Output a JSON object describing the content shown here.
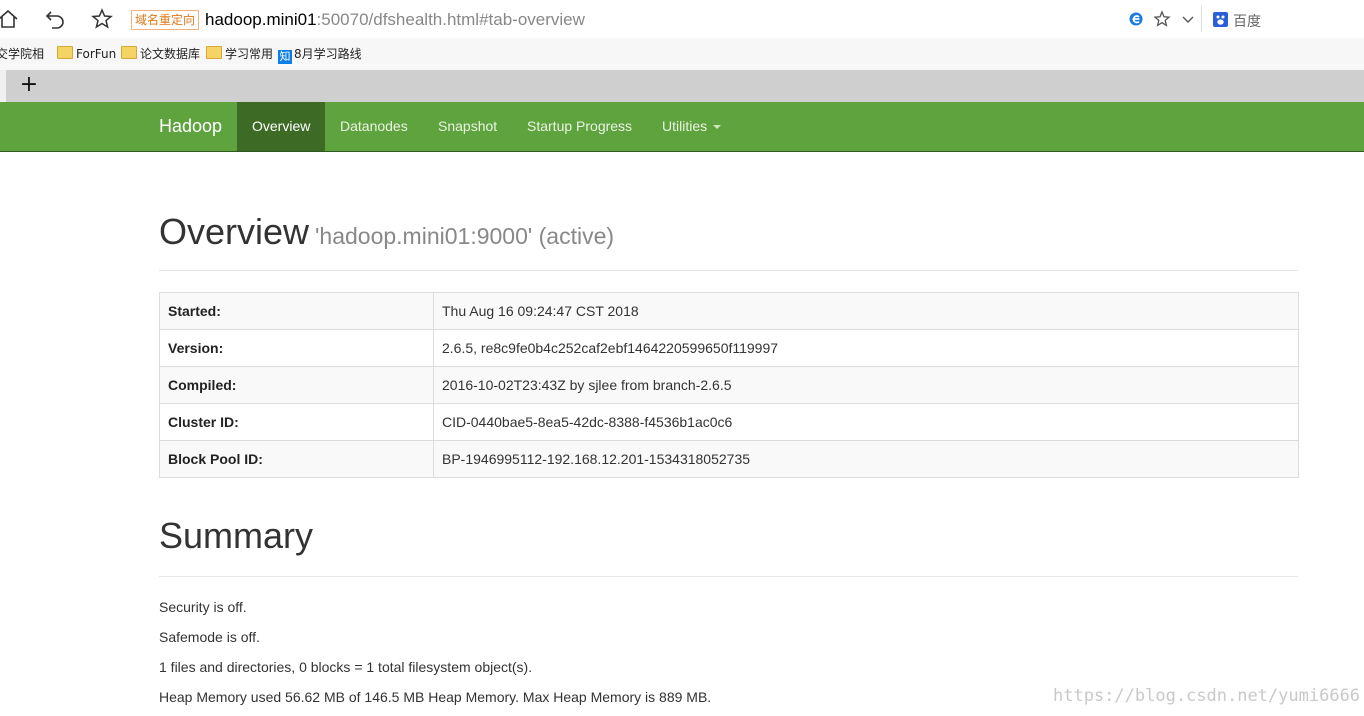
{
  "browser": {
    "redirect_badge": "域名重定向",
    "url_host": "hadoop.mini01",
    "url_rest": ":50070/dfshealth.html#tab-overview",
    "search_engine_label": "百度",
    "icons": [
      "home-icon",
      "undo-icon",
      "favorite-star-icon",
      "ie-compat-icon",
      "star-outline-icon",
      "chevron-down-icon",
      "baidu-icon"
    ]
  },
  "bookmarks": [
    {
      "label": "交学院相",
      "icon": "none"
    },
    {
      "label": "ForFun",
      "icon": "folder-icon"
    },
    {
      "label": "论文数据库",
      "icon": "folder-icon"
    },
    {
      "label": "学习常用",
      "icon": "folder-icon"
    },
    {
      "label": "8月学习路线",
      "icon": "zhihu-icon",
      "icon_text": "知"
    }
  ],
  "tabstrip": {
    "new_tab": "+"
  },
  "navbar": {
    "brand": "Hadoop",
    "items": [
      {
        "label": "Overview",
        "active": true
      },
      {
        "label": "Datanodes",
        "active": false
      },
      {
        "label": "Snapshot",
        "active": false
      },
      {
        "label": "Startup Progress",
        "active": false
      },
      {
        "label": "Utilities",
        "active": false,
        "dropdown": true
      }
    ],
    "colors": {
      "bar": "#5fa33e",
      "active": "#3d6b26"
    }
  },
  "overview": {
    "title": "Overview",
    "subtitle": "'hadoop.mini01:9000' (active)",
    "rows": [
      {
        "key": "Started:",
        "value": "Thu Aug 16 09:24:47 CST 2018"
      },
      {
        "key": "Version:",
        "value": "2.6.5, re8c9fe0b4c252caf2ebf1464220599650f119997"
      },
      {
        "key": "Compiled:",
        "value": "2016-10-02T23:43Z by sjlee from branch-2.6.5"
      },
      {
        "key": "Cluster ID:",
        "value": "CID-0440bae5-8ea5-42dc-8388-f4536b1ac0c6"
      },
      {
        "key": "Block Pool ID:",
        "value": "BP-1946995112-192.168.12.201-1534318052735"
      }
    ]
  },
  "summary": {
    "title": "Summary",
    "lines": [
      "Security is off.",
      "Safemode is off.",
      "1 files and directories, 0 blocks = 1 total filesystem object(s).",
      "Heap Memory used 56.62 MB of 146.5 MB Heap Memory. Max Heap Memory is 889 MB."
    ]
  },
  "watermark": "https://blog.csdn.net/yumi6666"
}
